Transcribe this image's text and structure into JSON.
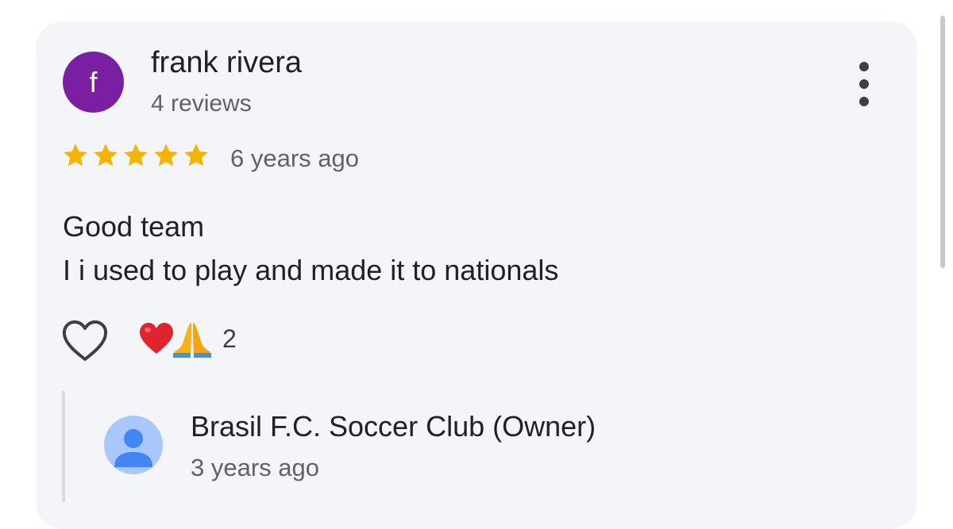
{
  "review": {
    "author": {
      "name": "frank rivera",
      "initial": "f",
      "reviews": "4 reviews",
      "avatar_color": "#7b1fa2"
    },
    "rating": 5,
    "star_color": "#f4b400",
    "time": "6 years ago",
    "text_lines": [
      "Good team",
      "I i used to play and made it to nationals"
    ],
    "reactions": {
      "like_icon": "heart-outline-icon",
      "emojis": [
        "red-heart-icon",
        "folded-hands-icon"
      ],
      "count": "2"
    },
    "menu_icon": "more-vertical-icon"
  },
  "owner_reply": {
    "name": "Brasil F.C. Soccer Club (Owner)",
    "time": "3 years ago",
    "avatar_icon": "person-icon"
  }
}
